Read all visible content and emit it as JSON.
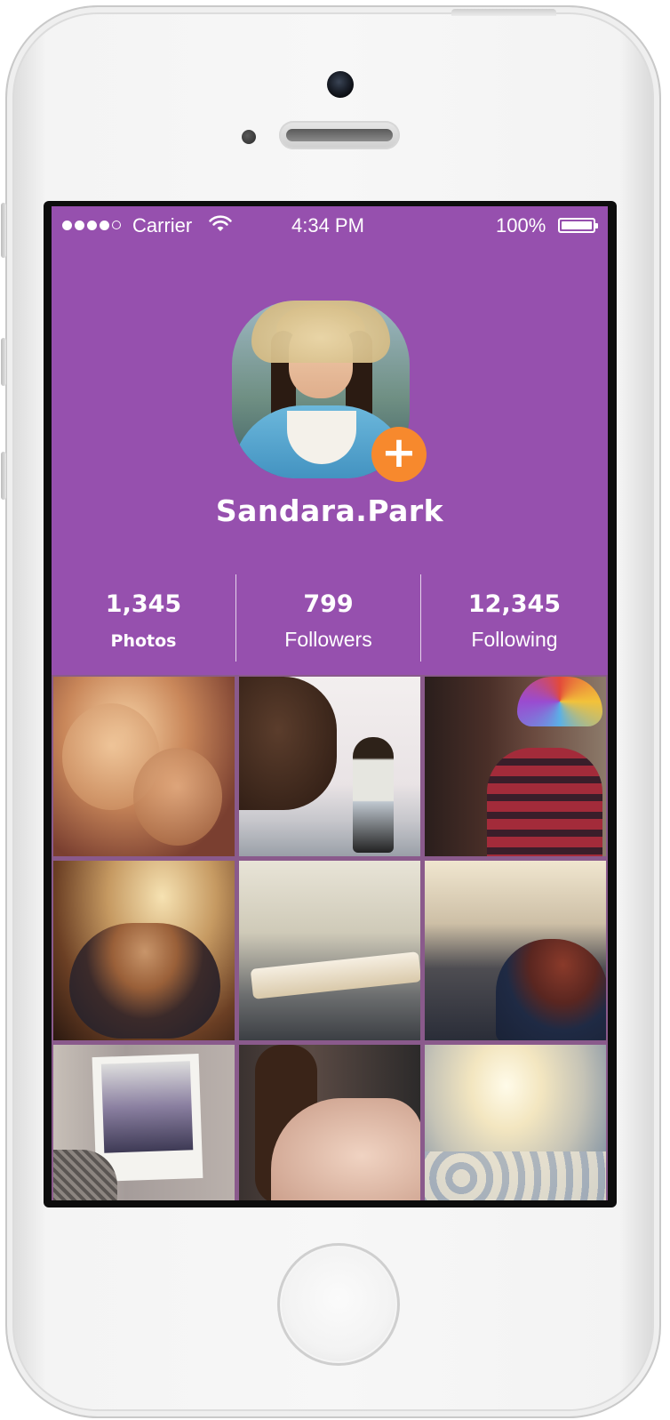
{
  "status_bar": {
    "carrier": "Carrier",
    "time": "4:34 PM",
    "battery": "100%",
    "signal_bars_filled": 4,
    "signal_bars_total": 5
  },
  "profile": {
    "username": "Sandara.Park",
    "add_button_icon": "plus-icon",
    "add_button_glyph": "+"
  },
  "stats": [
    {
      "value": "1,345",
      "label": "Photos"
    },
    {
      "value": "799",
      "label": "Followers"
    },
    {
      "value": "12,345",
      "label": "Following"
    }
  ],
  "colors": {
    "header_background": "#9650ae",
    "add_button": "#f7892d"
  },
  "photos": [
    {
      "subject": "underwater-faces"
    },
    {
      "subject": "horse-and-woman"
    },
    {
      "subject": "masked-person-rainbow-wig"
    },
    {
      "subject": "coffee-cup"
    },
    {
      "subject": "notebook"
    },
    {
      "subject": "woman-on-bridge"
    },
    {
      "subject": "polaroid-street"
    },
    {
      "subject": "shoulder-hand"
    },
    {
      "subject": "sun-over-clouds"
    }
  ]
}
